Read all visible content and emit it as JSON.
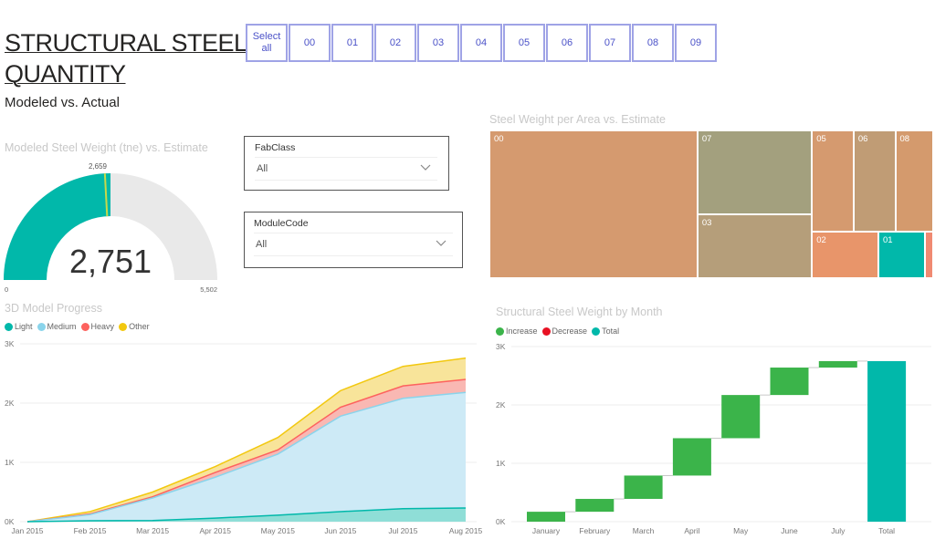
{
  "header": {
    "title_line1": "STRUCTURAL STEEL",
    "title_line2": "QUANTITY",
    "subtitle": "Modeled vs. Actual"
  },
  "area_slicer": {
    "buttons": [
      {
        "label": "Select all"
      },
      {
        "label": "00"
      },
      {
        "label": "01"
      },
      {
        "label": "02"
      },
      {
        "label": "03"
      },
      {
        "label": "04"
      },
      {
        "label": "05"
      },
      {
        "label": "06"
      },
      {
        "label": "07"
      },
      {
        "label": "08"
      },
      {
        "label": "09"
      }
    ]
  },
  "filters": {
    "fabclass": {
      "label": "FabClass",
      "value": "All",
      "icon": "chevron-down-icon"
    },
    "modulecode": {
      "label": "ModuleCode",
      "value": "All",
      "icon": "chevron-down-icon"
    }
  },
  "colors": {
    "teal": "#01b8aa",
    "gauge_bg": "#e9e9e9",
    "target": "#c6d94a",
    "increase": "#3bb44a",
    "decrease": "#e81123",
    "total": "#01b8aa",
    "light": "#01b8aa",
    "medium": "#8ad4eb",
    "heavy": "#fd625e",
    "other": "#f2c80f"
  },
  "chart_data": [
    {
      "type": "gauge",
      "title": "Modeled Steel Weight (tne) vs. Estimate",
      "value": 2751,
      "value_label": "2,751",
      "min": 0,
      "min_label": "0",
      "max": 5502,
      "max_label": "5,502",
      "target": 2659,
      "target_label": "2,659"
    },
    {
      "type": "treemap",
      "title": "Steel Weight per Area vs. Estimate",
      "items": [
        {
          "label": "00",
          "value": 40,
          "color": "#d59a6f"
        },
        {
          "label": "07",
          "value": 12.5,
          "color": "#a3a07e"
        },
        {
          "label": "03",
          "value": 9.5,
          "color": "#b59e7a"
        },
        {
          "label": "05",
          "value": 5.5,
          "color": "#d59a6f"
        },
        {
          "label": "06",
          "value": 5.5,
          "color": "#c09c75"
        },
        {
          "label": "08",
          "value": 5.0,
          "color": "#d49a6d"
        },
        {
          "label": "02",
          "value": 4.0,
          "color": "#e8956a"
        },
        {
          "label": "01",
          "value": 2.8,
          "color": "#01b8aa"
        },
        {
          "label": "",
          "value": 0.5,
          "color": "#f08a72"
        }
      ]
    },
    {
      "type": "area",
      "stacked": true,
      "title": "3D Model Progress",
      "legend": [
        "Light",
        "Medium",
        "Heavy",
        "Other"
      ],
      "legend_position": "top-left",
      "x": [
        "Jan 2015",
        "Feb 2015",
        "Mar 2015",
        "Apr 2015",
        "May 2015",
        "Jun 2015",
        "Jul 2015",
        "Aug 2015"
      ],
      "series": [
        {
          "name": "Light",
          "values": [
            0,
            15,
            20,
            60,
            110,
            170,
            220,
            230
          ]
        },
        {
          "name": "Medium",
          "values": [
            0,
            105,
            380,
            690,
            1030,
            1610,
            1860,
            1950
          ]
        },
        {
          "name": "Heavy",
          "values": [
            0,
            10,
            20,
            80,
            70,
            150,
            210,
            220
          ]
        },
        {
          "name": "Other",
          "values": [
            0,
            40,
            80,
            100,
            210,
            280,
            330,
            360
          ]
        }
      ],
      "yticks": [
        "0K",
        "1K",
        "2K",
        "3K"
      ],
      "ylim": [
        0,
        3000
      ],
      "grid": true
    },
    {
      "type": "waterfall",
      "title": "Structural Steel Weight by Month",
      "legend": [
        "Increase",
        "Decrease",
        "Total"
      ],
      "legend_position": "top-left",
      "categories": [
        "January",
        "February",
        "March",
        "April",
        "May",
        "June",
        "July",
        "Total"
      ],
      "values": [
        170,
        220,
        400,
        640,
        740,
        470,
        111,
        2751
      ],
      "yticks": [
        "0K",
        "1K",
        "2K",
        "3K"
      ],
      "ylim": [
        0,
        3000
      ],
      "grid": true
    }
  ]
}
